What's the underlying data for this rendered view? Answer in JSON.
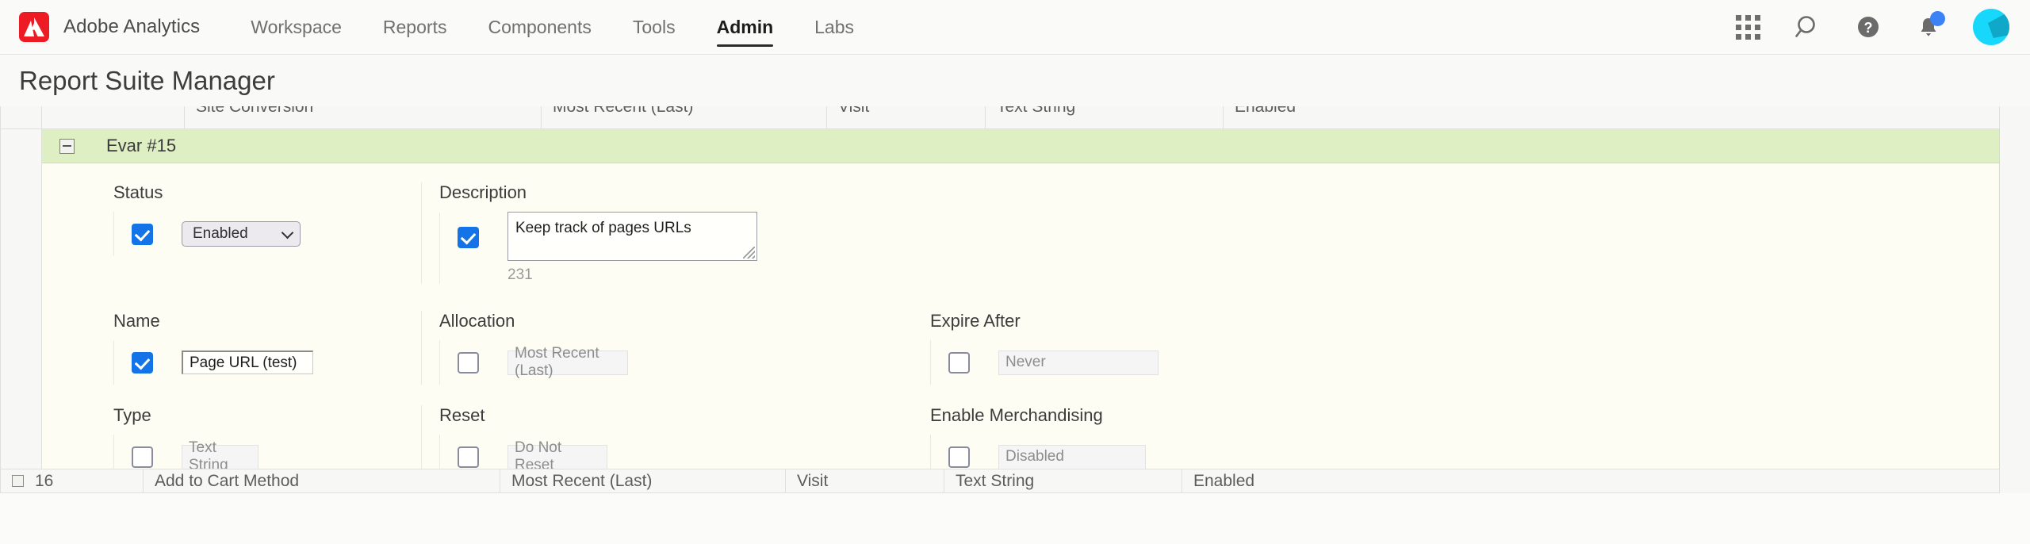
{
  "topnav": {
    "brand": "Adobe Analytics",
    "logo_icon": "adobe-logo-icon",
    "items": [
      {
        "label": "Workspace",
        "active": false
      },
      {
        "label": "Reports",
        "active": false
      },
      {
        "label": "Components",
        "active": false
      },
      {
        "label": "Tools",
        "active": false
      },
      {
        "label": "Admin",
        "active": true
      },
      {
        "label": "Labs",
        "active": false
      }
    ],
    "right_icons": [
      "app-grid-icon",
      "search-icon",
      "help-icon",
      "notifications-bell-icon",
      "avatar"
    ],
    "notification_badge": true
  },
  "header": {
    "title": "Report Suite Manager"
  },
  "clipped_top_row": {
    "col_conversion": "Site Conversion",
    "col_allocation": "Most Recent (Last)",
    "col_reset": "Visit",
    "col_type": "Text String",
    "col_status": "Enabled"
  },
  "panel": {
    "title": "Evar #15",
    "collapse_icon": "collapse-minus-icon",
    "fields": {
      "status": {
        "label": "Status",
        "checked": true,
        "value": "Enabled",
        "control": "select"
      },
      "description": {
        "label": "Description",
        "checked": true,
        "value": "Keep track of pages URLs",
        "char_count": "231",
        "control": "textarea"
      },
      "name": {
        "label": "Name",
        "checked": true,
        "value": "Page URL (test)",
        "control": "text"
      },
      "allocation": {
        "label": "Allocation",
        "checked": false,
        "value": "Most Recent (Last)",
        "control": "disabled"
      },
      "expire_after": {
        "label": "Expire After",
        "checked": false,
        "value": "Never",
        "control": "disabled"
      },
      "type": {
        "label": "Type",
        "checked": false,
        "value": "Text String",
        "control": "disabled"
      },
      "reset": {
        "label": "Reset",
        "checked": false,
        "value": "Do Not Reset",
        "control": "disabled"
      },
      "enable_merchandising": {
        "label": "Enable Merchandising",
        "checked": false,
        "value": "Disabled",
        "control": "disabled"
      }
    }
  },
  "clipped_bottom_row": {
    "index": "16",
    "name": "Add to Cart Method",
    "allocation": "Most Recent (Last)",
    "expire": "Visit",
    "type": "Text String",
    "status": "Enabled"
  },
  "colors": {
    "accent_blue": "#1473e6",
    "panel_header_green": "#ddefc3",
    "adobe_red": "#ed1c24",
    "avatar_cyan": "#17d7fb"
  }
}
